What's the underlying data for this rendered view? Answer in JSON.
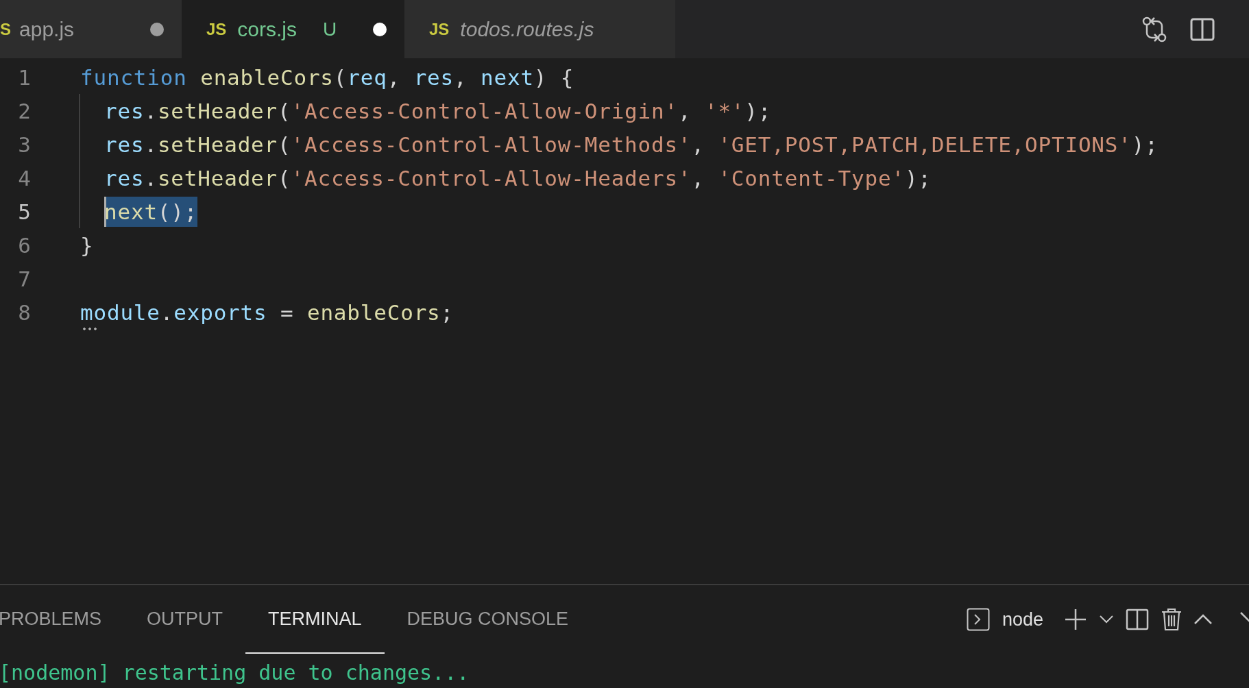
{
  "tabs": [
    {
      "icon": "S",
      "label": "app.js",
      "selected": false,
      "dirty": true,
      "untracked": false,
      "preview": false
    },
    {
      "icon": "JS",
      "label": "cors.js",
      "git_status": "U",
      "selected": true,
      "dirty": true,
      "untracked": true,
      "preview": false
    },
    {
      "icon": "JS",
      "label": "todos.routes.js",
      "selected": false,
      "dirty": false,
      "untracked": false,
      "preview": true
    }
  ],
  "editor": {
    "lines": [
      {
        "number": "1",
        "active": false,
        "indented": false,
        "tokens": [
          {
            "text": "function ",
            "kind": "keyword"
          },
          {
            "text": "enableCors",
            "kind": "function"
          },
          {
            "text": "(",
            "kind": "punct"
          },
          {
            "text": "req",
            "kind": "variable"
          },
          {
            "text": ", ",
            "kind": "punct"
          },
          {
            "text": "res",
            "kind": "variable"
          },
          {
            "text": ", ",
            "kind": "punct"
          },
          {
            "text": "next",
            "kind": "variable"
          },
          {
            "text": ") {",
            "kind": "punct"
          }
        ]
      },
      {
        "number": "2",
        "active": false,
        "indented": true,
        "tokens": [
          {
            "text": "res",
            "kind": "variable"
          },
          {
            "text": ".",
            "kind": "punct"
          },
          {
            "text": "setHeader",
            "kind": "function"
          },
          {
            "text": "(",
            "kind": "punct"
          },
          {
            "text": "'Access-Control-Allow-Origin'",
            "kind": "string"
          },
          {
            "text": ", ",
            "kind": "punct"
          },
          {
            "text": "'*'",
            "kind": "string"
          },
          {
            "text": ");",
            "kind": "punct"
          }
        ]
      },
      {
        "number": "3",
        "active": false,
        "indented": true,
        "tokens": [
          {
            "text": "res",
            "kind": "variable"
          },
          {
            "text": ".",
            "kind": "punct"
          },
          {
            "text": "setHeader",
            "kind": "function"
          },
          {
            "text": "(",
            "kind": "punct"
          },
          {
            "text": "'Access-Control-Allow-Methods'",
            "kind": "string"
          },
          {
            "text": ", ",
            "kind": "punct"
          },
          {
            "text": "'GET,POST,PATCH,DELETE,OPTIONS'",
            "kind": "string"
          },
          {
            "text": ");",
            "kind": "punct"
          }
        ]
      },
      {
        "number": "4",
        "active": false,
        "indented": true,
        "tokens": [
          {
            "text": "res",
            "kind": "variable"
          },
          {
            "text": ".",
            "kind": "punct"
          },
          {
            "text": "setHeader",
            "kind": "function"
          },
          {
            "text": "(",
            "kind": "punct"
          },
          {
            "text": "'Access-Control-Allow-Headers'",
            "kind": "string"
          },
          {
            "text": ", ",
            "kind": "punct"
          },
          {
            "text": "'Content-Type'",
            "kind": "string"
          },
          {
            "text": ");",
            "kind": "punct"
          }
        ]
      },
      {
        "number": "5",
        "active": true,
        "indented": true,
        "tokens": [
          {
            "text": "next",
            "kind": "function",
            "selected": true,
            "cursor": true
          },
          {
            "text": "();",
            "kind": "punct",
            "selected": true
          }
        ]
      },
      {
        "number": "6",
        "active": false,
        "indented": false,
        "tokens": [
          {
            "text": "}",
            "kind": "punct"
          }
        ]
      },
      {
        "number": "7",
        "active": false,
        "indented": false
      },
      {
        "number": "8",
        "active": false,
        "indented": false,
        "tokens": [
          {
            "text": "module",
            "kind": "variable",
            "hint": true
          },
          {
            "text": ".",
            "kind": "punct"
          },
          {
            "text": "exports",
            "kind": "variable"
          },
          {
            "text": " = ",
            "kind": "punct"
          },
          {
            "text": "enableCors",
            "kind": "function"
          },
          {
            "text": ";",
            "kind": "punct"
          }
        ]
      }
    ]
  },
  "panel": {
    "tabs": [
      {
        "label": "PROBLEMS",
        "selected": false
      },
      {
        "label": "OUTPUT",
        "selected": false
      },
      {
        "label": "TERMINAL",
        "selected": true
      },
      {
        "label": "DEBUG CONSOLE",
        "selected": false
      }
    ],
    "terminal_name": "node",
    "output": "[nodemon] restarting due to changes..."
  }
}
